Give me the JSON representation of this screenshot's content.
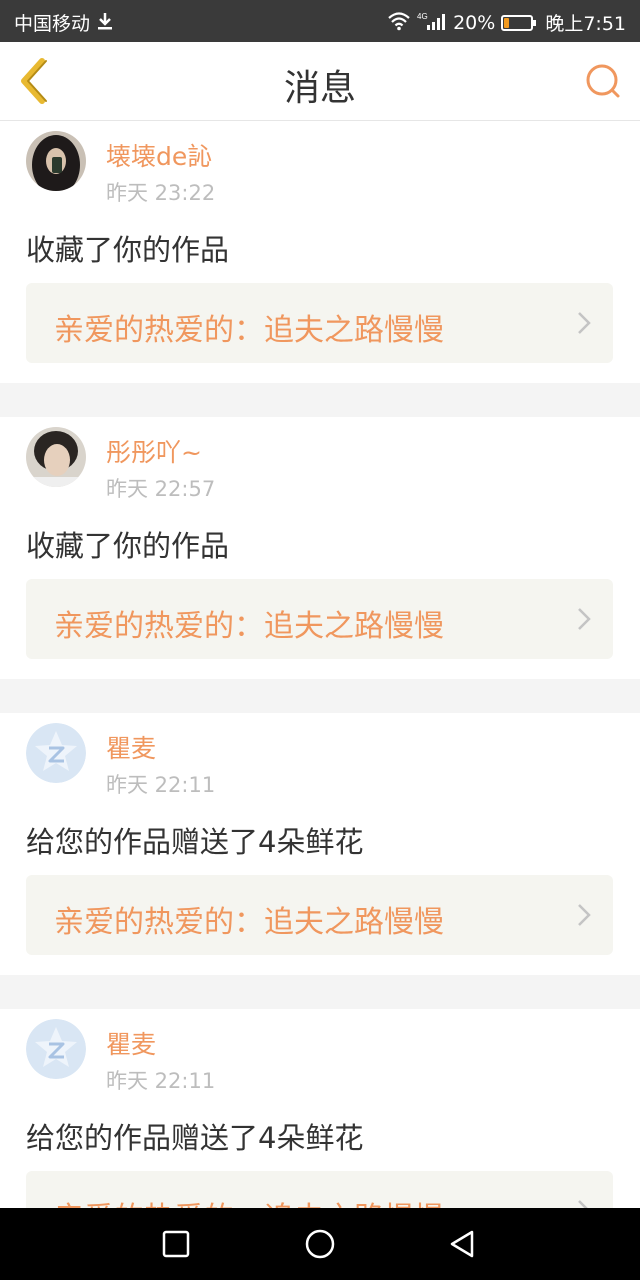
{
  "status_bar": {
    "carrier": "中国移动",
    "network": "4G",
    "battery": "20%",
    "battery_level": 0.2,
    "time": "晚上7:51"
  },
  "header": {
    "title": "消息",
    "back_icon": "chevron-left-icon",
    "search_icon": "search-icon"
  },
  "notifications": [
    {
      "username": "壊壊de訫",
      "time": "昨天 23:22",
      "message": "收藏了你的作品",
      "work": "亲爱的热爱的：追夫之路慢慢"
    },
    {
      "username": "彤彤吖~",
      "time": "昨天 22:57",
      "message": "收藏了你的作品",
      "work": "亲爱的热爱的：追夫之路慢慢"
    },
    {
      "username": "瞿麦",
      "time": "昨天 22:11",
      "message": "给您的作品赠送了4朵鲜花",
      "work": "亲爱的热爱的：追夫之路慢慢"
    },
    {
      "username": "瞿麦",
      "time": "昨天 22:11",
      "message": "给您的作品赠送了4朵鲜花",
      "work": "亲爱的热爱的：追夫之路慢慢"
    }
  ],
  "colors": {
    "accent": "#f0975e",
    "back_icon": "#e8b931",
    "link_bg": "#f5f5f0",
    "status_bar": "#3a3a3a"
  }
}
